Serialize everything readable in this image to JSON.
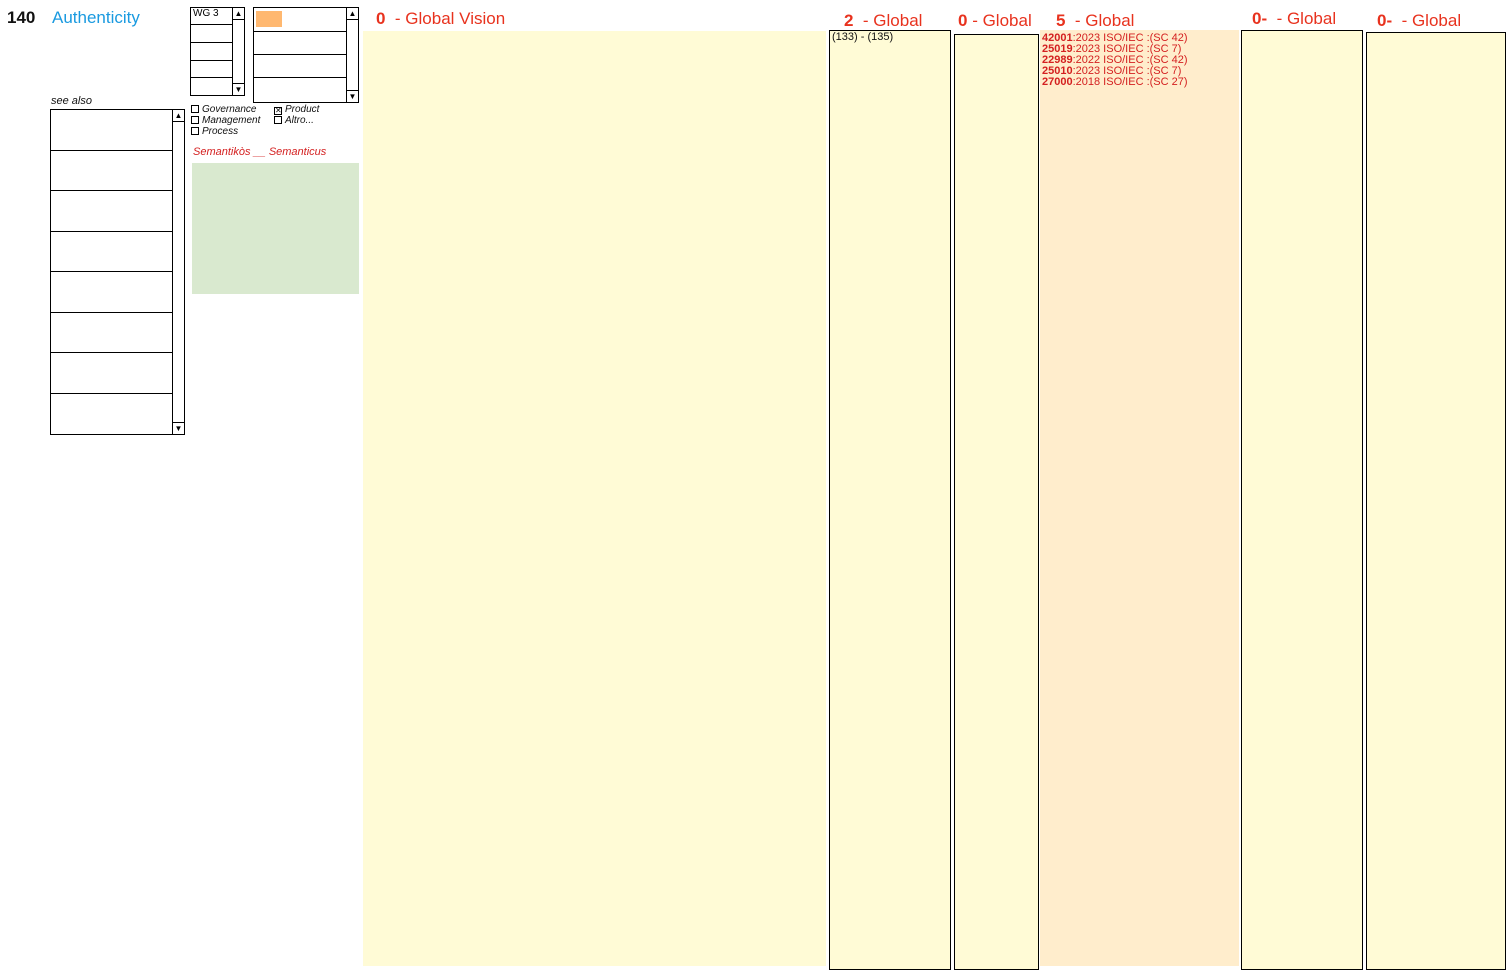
{
  "record": {
    "number": "140",
    "term": "Authenticity"
  },
  "wg_list": {
    "items": [
      "WG 3",
      "",
      "",
      "",
      ""
    ]
  },
  "color_list": {
    "selected_color": "#ffb870",
    "items": [
      "",
      "",
      "",
      ""
    ]
  },
  "see_also": {
    "label": "see also",
    "rows": [
      "",
      "",
      "",
      "",
      "",
      "",
      "",
      ""
    ]
  },
  "categories": {
    "governance": {
      "label": "Governance",
      "checked": false
    },
    "product": {
      "label": "Product",
      "checked": true
    },
    "management": {
      "label": "Management",
      "checked": false
    },
    "altro": {
      "label": "Altro...",
      "checked": false
    },
    "process": {
      "label": "Process",
      "checked": false
    }
  },
  "etymology": {
    "text": "Semantikòs __ Semanticus"
  },
  "columns": {
    "global_vision": {
      "count": "0",
      "label": "- Global Vision"
    },
    "col2": {
      "count": "2",
      "label": "- Global",
      "content": "(133) - (135)"
    },
    "col3": {
      "count": "0",
      "label": "- Global"
    },
    "col4": {
      "count": "5",
      "label": "- Global",
      "standards": [
        {
          "code": "42001",
          "rest": ":2023 ISO/IEC :(SC 42)"
        },
        {
          "code": "25019",
          "rest": ":2023 ISO/IEC :(SC 7)"
        },
        {
          "code": "22989",
          "rest": ":2022 ISO/IEC :(SC 42)"
        },
        {
          "code": "25010",
          "rest": ":2023 ISO/IEC :(SC 7)"
        },
        {
          "code": "27000",
          "rest": ":2018 ISO/IEC :(SC 27)"
        }
      ]
    },
    "col5": {
      "count": "0-",
      "label": "- Global"
    },
    "col6": {
      "count": "0-",
      "label": "- Global"
    }
  },
  "colors": {
    "title": "#1a9ae0",
    "accent_red": "#e8321e",
    "column_bg": "#fffbd6",
    "standards_bg": "#ffedcc",
    "definition_bg": "#d9e9cf"
  }
}
